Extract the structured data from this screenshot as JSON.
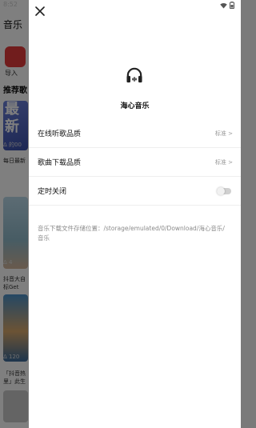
{
  "status_bar": {
    "time": "8:52"
  },
  "background": {
    "title": "音乐",
    "import_label": "导入",
    "section_title": "推荐歌",
    "card1_big": "最新",
    "card1_small": "Δ 的00",
    "caption1": "每日最新",
    "card2_small": "Δ 4",
    "caption2_line1": "抖音大自",
    "caption2_line2": "标Get",
    "card3_small": "Δ 120",
    "caption3_line1": "「抖音热",
    "caption3_line2": "里」此生"
  },
  "drawer": {
    "app_name": "海心音乐",
    "menu": [
      {
        "label": "在线听歌品质",
        "value": "标准 >"
      },
      {
        "label": "歌曲下载品质",
        "value": "标准 >"
      },
      {
        "label": "定时关闭",
        "toggle_on": false
      }
    ],
    "storage_path": "音乐下载文件存储位置：/storage/emulated/0/Download/海心音乐/音乐"
  },
  "colors": {
    "accent_red": "#e23a3a",
    "divider": "#eeeeee",
    "muted_text": "#999999"
  },
  "icons": {
    "close": "close-icon",
    "logo": "headphones-icon",
    "wifi": "wifi-icon",
    "battery": "battery-icon"
  }
}
